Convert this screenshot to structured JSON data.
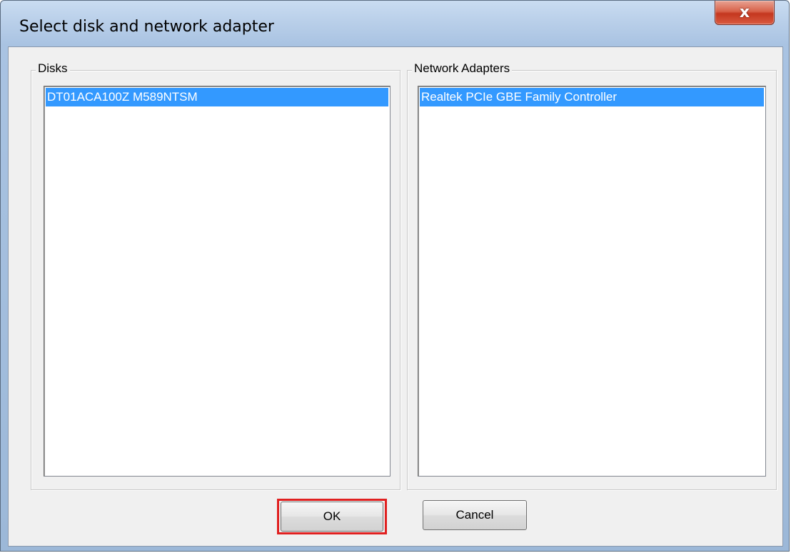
{
  "window": {
    "title": "Select disk and network adapter",
    "close_glyph": "x"
  },
  "disks": {
    "label": "Disks",
    "items": [
      "DT01ACA100Z M589NTSM"
    ],
    "selected_index": 0
  },
  "network_adapters": {
    "label": "Network Adapters",
    "items": [
      "Realtek PCIe GBE Family Controller"
    ],
    "selected_index": 0
  },
  "buttons": {
    "ok_label": "OK",
    "cancel_label": "Cancel"
  },
  "colors": {
    "selection": "#3399ff",
    "highlight": "#e02020",
    "close_button": "#c4371f"
  },
  "icons": {
    "close": "close-icon"
  }
}
